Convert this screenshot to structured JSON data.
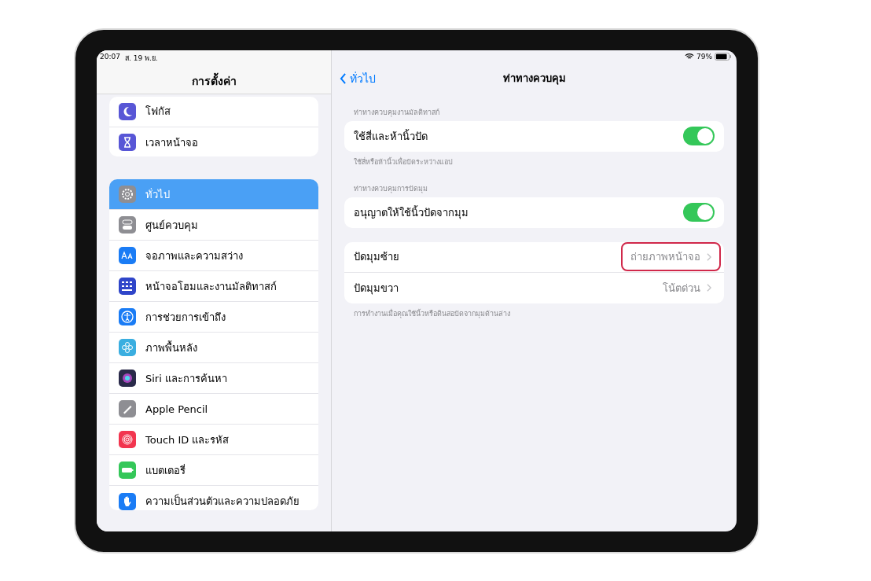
{
  "status_bar": {
    "time": "20:07",
    "date": "ส. 19 พ.ย.",
    "battery_text": "79%"
  },
  "sidebar": {
    "title": "การตั้งค่า",
    "groups": [
      {
        "items": [
          {
            "label": "โฟกัส",
            "color": "#5856d6",
            "selected": false
          },
          {
            "label": "เวลาหน้าจอ",
            "color": "#5856d6",
            "selected": false
          }
        ]
      },
      {
        "items": [
          {
            "label": "ทั่วไป",
            "color": "#8e8e93",
            "selected": true
          },
          {
            "label": "ศูนย์ควบคุม",
            "color": "#8e8e93",
            "selected": false
          },
          {
            "label": "จอภาพและความสว่าง",
            "color": "#1a7cf5",
            "selected": false
          },
          {
            "label": "หน้าจอโฮมและงานมัลติทาสก์",
            "color": "#2f45c9",
            "selected": false
          },
          {
            "label": "การช่วยการเข้าถึง",
            "color": "#1a7cf5",
            "selected": false
          },
          {
            "label": "ภาพพื้นหลัง",
            "color": "#3aaee0",
            "selected": false
          },
          {
            "label": "Siri และการค้นหา",
            "color": "#2a2a4a",
            "selected": false
          },
          {
            "label": "Apple Pencil",
            "color": "#8e8e93",
            "selected": false
          },
          {
            "label": "Touch ID และรหัส",
            "color": "#f2354f",
            "selected": false
          },
          {
            "label": "แบตเตอรี่",
            "color": "#34c759",
            "selected": false
          },
          {
            "label": "ความเป็นส่วนตัวและความปลอดภัย",
            "color": "#1a7cf5",
            "selected": false
          }
        ]
      }
    ]
  },
  "detail": {
    "back_label": "ทั่วไป",
    "title": "ท่าทางควบคุม",
    "sections": [
      {
        "header": "ท่าทางควบคุมงานมัลติทาสก์",
        "rows": [
          {
            "kind": "toggle",
            "label": "ใช้สี่และห้านิ้วปัด",
            "on": true
          }
        ],
        "footer": "ใช้สี่หรือห้านิ้วเพื่อปัดระหว่างแอป"
      },
      {
        "header": "ท่าทางควบคุมการปัดมุม",
        "rows": [
          {
            "kind": "toggle",
            "label": "อนุญาตให้ใช้นิ้วปัดจากมุม",
            "on": true
          }
        ]
      },
      {
        "rows": [
          {
            "kind": "link",
            "label": "ปัดมุมซ้าย",
            "value": "ถ่ายภาพหน้าจอ",
            "highlighted": true
          },
          {
            "kind": "link",
            "label": "ปัดมุมขวา",
            "value": "โน้ตด่วน",
            "highlighted": false
          }
        ],
        "footer": "การทำงานเมื่อคุณใช้นิ้วหรือดินสอปัดจากมุมด้านล่าง"
      }
    ]
  }
}
